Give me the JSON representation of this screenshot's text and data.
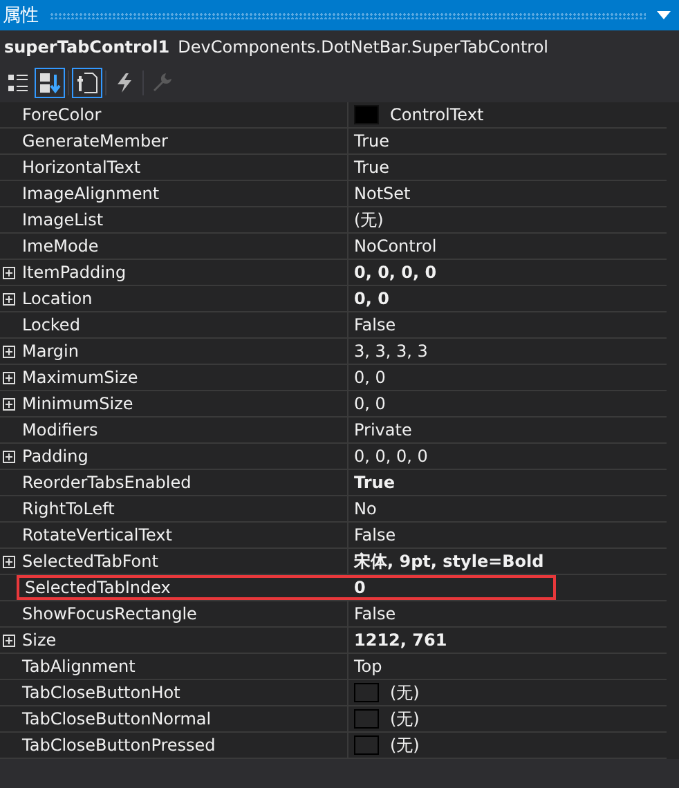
{
  "window": {
    "title": "属性"
  },
  "object": {
    "name": "superTabControl1",
    "type": "DevComponents.DotNetBar.SuperTabControl"
  },
  "toolbar": [
    {
      "kind": "categorized",
      "selected": false,
      "disabled": false
    },
    {
      "kind": "alphabetical",
      "selected": true,
      "disabled": false
    },
    {
      "kind": "properties",
      "selected": true,
      "disabled": false
    },
    {
      "kind": "events",
      "selected": false,
      "disabled": false
    },
    {
      "kind": "pages",
      "selected": false,
      "disabled": true
    }
  ],
  "properties": [
    {
      "name": "ForeColor",
      "value": "ControlText",
      "kind": "color",
      "color": "#000000",
      "expandable": false,
      "bold": false,
      "selected": false
    },
    {
      "name": "GenerateMember",
      "value": "True",
      "kind": "text",
      "expandable": false,
      "bold": false,
      "selected": false
    },
    {
      "name": "HorizontalText",
      "value": "True",
      "kind": "text",
      "expandable": false,
      "bold": false,
      "selected": false
    },
    {
      "name": "ImageAlignment",
      "value": "NotSet",
      "kind": "text",
      "expandable": false,
      "bold": false,
      "selected": false
    },
    {
      "name": "ImageList",
      "value": "(无)",
      "kind": "text",
      "expandable": false,
      "bold": false,
      "selected": false
    },
    {
      "name": "ImeMode",
      "value": "NoControl",
      "kind": "text",
      "expandable": false,
      "bold": false,
      "selected": false
    },
    {
      "name": "ItemPadding",
      "value": "0, 0, 0, 0",
      "kind": "text",
      "expandable": true,
      "bold": true,
      "selected": false
    },
    {
      "name": "Location",
      "value": "0, 0",
      "kind": "text",
      "expandable": true,
      "bold": true,
      "selected": false
    },
    {
      "name": "Locked",
      "value": "False",
      "kind": "text",
      "expandable": false,
      "bold": false,
      "selected": false
    },
    {
      "name": "Margin",
      "value": "3, 3, 3, 3",
      "kind": "text",
      "expandable": true,
      "bold": false,
      "selected": false
    },
    {
      "name": "MaximumSize",
      "value": "0, 0",
      "kind": "text",
      "expandable": true,
      "bold": false,
      "selected": false
    },
    {
      "name": "MinimumSize",
      "value": "0, 0",
      "kind": "text",
      "expandable": true,
      "bold": false,
      "selected": false
    },
    {
      "name": "Modifiers",
      "value": "Private",
      "kind": "text",
      "expandable": false,
      "bold": false,
      "selected": false
    },
    {
      "name": "Padding",
      "value": "0, 0, 0, 0",
      "kind": "text",
      "expandable": true,
      "bold": false,
      "selected": false
    },
    {
      "name": "ReorderTabsEnabled",
      "value": "True",
      "kind": "text",
      "expandable": false,
      "bold": true,
      "selected": false
    },
    {
      "name": "RightToLeft",
      "value": "No",
      "kind": "text",
      "expandable": false,
      "bold": false,
      "selected": false
    },
    {
      "name": "RotateVerticalText",
      "value": "False",
      "kind": "text",
      "expandable": false,
      "bold": false,
      "selected": false
    },
    {
      "name": "SelectedTabFont",
      "value": "宋体, 9pt, style=Bold",
      "kind": "text",
      "expandable": true,
      "bold": true,
      "selected": false
    },
    {
      "name": "SelectedTabIndex",
      "value": "0",
      "kind": "text",
      "expandable": false,
      "bold": true,
      "selected": true
    },
    {
      "name": "ShowFocusRectangle",
      "value": "False",
      "kind": "text",
      "expandable": false,
      "bold": false,
      "selected": false
    },
    {
      "name": "Size",
      "value": "1212, 761",
      "kind": "text",
      "expandable": true,
      "bold": true,
      "selected": false
    },
    {
      "name": "TabAlignment",
      "value": "Top",
      "kind": "text",
      "expandable": false,
      "bold": false,
      "selected": false
    },
    {
      "name": "TabCloseButtonHot",
      "value": "(无)",
      "kind": "image",
      "expandable": false,
      "bold": false,
      "selected": false
    },
    {
      "name": "TabCloseButtonNormal",
      "value": "(无)",
      "kind": "image",
      "expandable": false,
      "bold": false,
      "selected": false
    },
    {
      "name": "TabCloseButtonPressed",
      "value": "(无)",
      "kind": "image",
      "expandable": false,
      "bold": false,
      "selected": false
    }
  ]
}
